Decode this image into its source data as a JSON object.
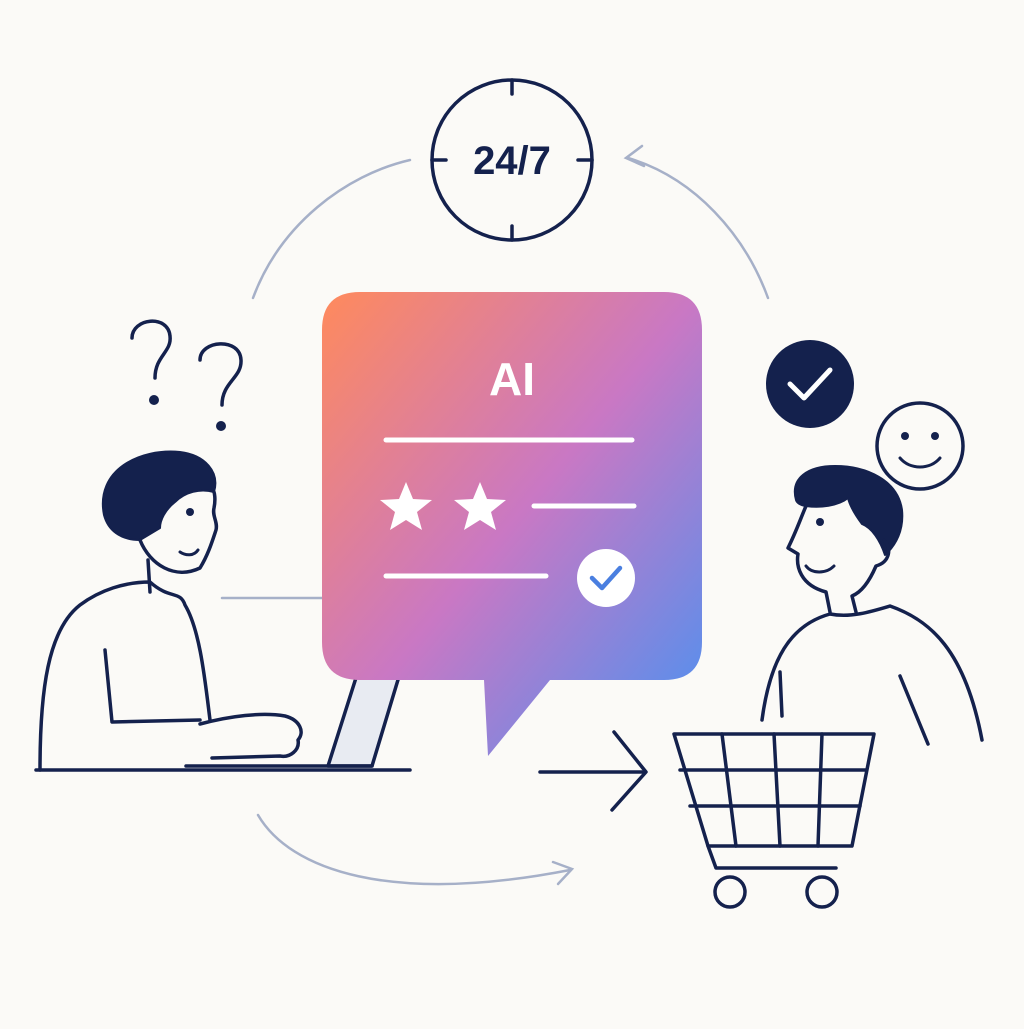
{
  "clock": {
    "label": "24/7"
  },
  "chat_bubble": {
    "label": "AI"
  },
  "colors": {
    "ink": "#14214d",
    "flow_arrow": "#a6b0c8",
    "bubble_gradient_start": "#ff8a5c",
    "bubble_gradient_mid": "#c978c4",
    "bubble_gradient_end": "#4892f2",
    "background": "#fbfaf7"
  },
  "icons": [
    "clock-icon",
    "question-mark-icon",
    "star-icon",
    "check-circle-icon",
    "smiley-icon",
    "shopping-cart-icon",
    "arrow-right-icon",
    "laptop-icon"
  ]
}
